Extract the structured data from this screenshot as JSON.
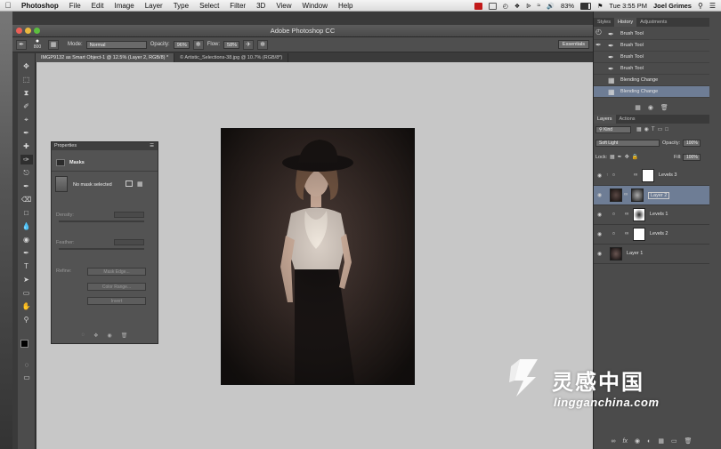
{
  "menubar": {
    "app_name": "Photoshop",
    "items": [
      "File",
      "Edit",
      "Image",
      "Layer",
      "Type",
      "Select",
      "Filter",
      "3D",
      "View",
      "Window",
      "Help"
    ],
    "battery": "83%",
    "clock": "Tue 3:55 PM",
    "user": "Joel Grimes"
  },
  "window": {
    "title": "Adobe Photoshop CC"
  },
  "options_bar": {
    "brush_size": "800",
    "mode_label": "Mode:",
    "mode_value": "Normal",
    "opacity_label": "Opacity:",
    "opacity_value": "96%",
    "flow_label": "Flow:",
    "flow_value": "58%",
    "workspace": "Essentials"
  },
  "doc_tabs": [
    "IMGP9132 as Smart Object-1 @ 12.5% (Layer 2, RGB/8) *",
    "© Artistic_Selections-38.jpg @ 10.7% (RGB/8*)"
  ],
  "properties": {
    "header": "Properties",
    "section": "Masks",
    "status": "No mask selected",
    "density_label": "Density:",
    "feather_label": "Feather:",
    "refine_label": "Refine:",
    "mask_edge": "Mask Edge...",
    "color_range": "Color Range...",
    "invert": "Invert"
  },
  "history": {
    "tabs": [
      "Styles",
      "History",
      "Adjustments"
    ],
    "items": [
      "Brush Tool",
      "Brush Tool",
      "Brush Tool",
      "Brush Tool",
      "Blending Change",
      "Blending Change"
    ]
  },
  "layers": {
    "tabs": [
      "Layers",
      "Actions"
    ],
    "kind": "Kind",
    "blend_mode": "Soft Light",
    "opacity_label": "Opacity:",
    "opacity_value": "100%",
    "lock_label": "Lock:",
    "fill_label": "Fill:",
    "fill_value": "100%",
    "items": [
      "Levels 3",
      "Layer 2",
      "Levels 1",
      "Levels 2",
      "Layer 1"
    ]
  },
  "watermark": {
    "cn": "灵感中国",
    "en": "lingganchina.com"
  },
  "colors": {
    "selection": "#6e7d95",
    "canvas_bg": "#c7c7c7"
  }
}
